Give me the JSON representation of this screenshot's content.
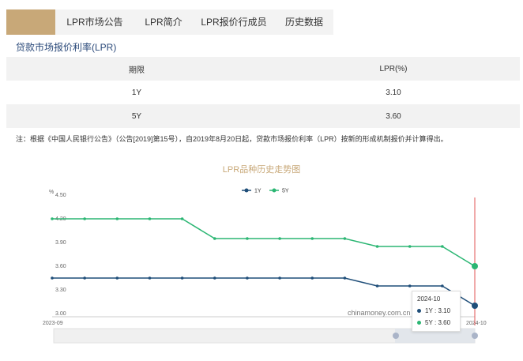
{
  "tabs": [
    {
      "label": ""
    },
    {
      "label": "LPR市场公告"
    },
    {
      "label": "LPR简介"
    },
    {
      "label": "LPR报价行成员"
    },
    {
      "label": "历史数据"
    }
  ],
  "section_title": "贷款市场报价利率(LPR)",
  "table": {
    "headers": [
      "期限",
      "LPR(%)"
    ],
    "rows": [
      {
        "term": "1Y",
        "rate": "3.10"
      },
      {
        "term": "5Y",
        "rate": "3.60"
      }
    ]
  },
  "note": "注：根据《中国人民银行公告》（公告[2019]第15号），自2019年8月20日起，贷款市场报价利率（LPR）按新的形成机制报价并计算得出。",
  "chart": {
    "title": "LPR品种历史走势图",
    "y_unit": "%",
    "watermark": "chinamoney.com.cn",
    "tooltip": {
      "date": "2024-10",
      "rows": [
        {
          "name": "1Y",
          "value": "3.10"
        },
        {
          "name": "5Y",
          "value": "3.60"
        }
      ]
    }
  },
  "colors": {
    "series_1y": "#1f4e79",
    "series_5y": "#2bb673",
    "accent": "#c8a878",
    "cursor": "#e05555"
  },
  "chart_data": {
    "type": "line",
    "x_tick_labels": [
      "2023-09",
      "2024-10"
    ],
    "y_tick_labels": [
      "3.00",
      "3.30",
      "3.60",
      "3.90",
      "4.20",
      "4.50"
    ],
    "ylim": [
      3.0,
      4.5
    ],
    "grid": false,
    "legend": "top-center",
    "series": [
      {
        "name": "1Y",
        "values": [
          3.45,
          3.45,
          3.45,
          3.45,
          3.45,
          3.45,
          3.45,
          3.45,
          3.45,
          3.45,
          3.35,
          3.35,
          3.35,
          3.1
        ]
      },
      {
        "name": "5Y",
        "values": [
          4.2,
          4.2,
          4.2,
          4.2,
          4.2,
          3.95,
          3.95,
          3.95,
          3.95,
          3.95,
          3.85,
          3.85,
          3.85,
          3.6
        ]
      }
    ]
  }
}
